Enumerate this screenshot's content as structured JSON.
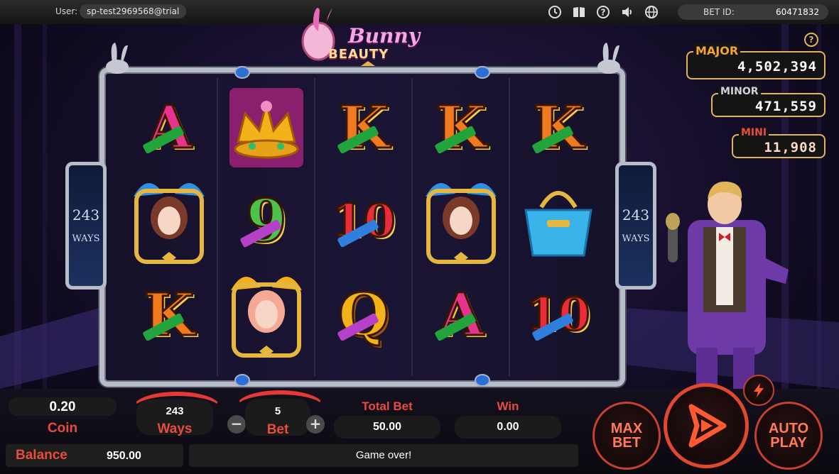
{
  "topbar": {
    "user_label": "User:",
    "user_value": "sp-test2969568@trial",
    "icons": [
      "clock-icon",
      "book-icon",
      "help-icon",
      "sound-icon",
      "globe-icon"
    ],
    "bet_id_label": "BET ID:",
    "bet_id_value": "60471832"
  },
  "logo": {
    "line1": "Bunny",
    "line2": "BEAUTY"
  },
  "jackpots": {
    "major": {
      "label": "MAJOR",
      "value": "4,502,394",
      "color": "#f0a43a"
    },
    "minor": {
      "label": "MINOR",
      "value": "471,559",
      "color": "#cfd3dd"
    },
    "mini": {
      "label": "MINI",
      "value": "11,908",
      "color": "#e84c3c"
    },
    "help": "?"
  },
  "ways_panel": {
    "number": "243",
    "label": "WAYS"
  },
  "reels": [
    [
      {
        "type": "letter",
        "text": "A",
        "cls": "L-A"
      },
      {
        "type": "bunny-girl",
        "name": "blue-bunny-girl"
      },
      {
        "type": "letter",
        "text": "K",
        "cls": "L-K"
      }
    ],
    [
      {
        "type": "crown",
        "name": "jeweled-crown"
      },
      {
        "type": "letter",
        "text": "9",
        "cls": "L-9"
      },
      {
        "type": "bunny-girl",
        "name": "pink-bunny-girl"
      }
    ],
    [
      {
        "type": "letter",
        "text": "K",
        "cls": "L-K"
      },
      {
        "type": "letter",
        "text": "10",
        "cls": "L-10"
      },
      {
        "type": "letter",
        "text": "Q",
        "cls": "L-Q"
      }
    ],
    [
      {
        "type": "letter",
        "text": "K",
        "cls": "L-K"
      },
      {
        "type": "bunny-girl",
        "name": "blue-bunny-girl"
      },
      {
        "type": "letter",
        "text": "A",
        "cls": "L-A"
      }
    ],
    [
      {
        "type": "letter",
        "text": "K",
        "cls": "L-K"
      },
      {
        "type": "handbag",
        "name": "blue-handbag"
      },
      {
        "type": "letter",
        "text": "10",
        "cls": "L-10"
      }
    ]
  ],
  "controls": {
    "coin_value": "0.20",
    "coin_label": "Coin",
    "ways_value": "243",
    "ways_label": "Ways",
    "bet_value": "5",
    "bet_label": "Bet",
    "minus": "−",
    "plus": "+",
    "total_bet_label": "Total Bet",
    "total_bet_value": "50.00",
    "win_label": "Win",
    "win_value": "0.00",
    "balance_label": "Balance",
    "balance_value": "950.00",
    "message": "Game over!",
    "max_bet_line1": "MAX",
    "max_bet_line2": "BET",
    "auto_play_line1": "AUTO",
    "auto_play_line2": "PLAY"
  },
  "colors": {
    "accent_red": "#e84c3c",
    "gold": "#e2b45c"
  }
}
